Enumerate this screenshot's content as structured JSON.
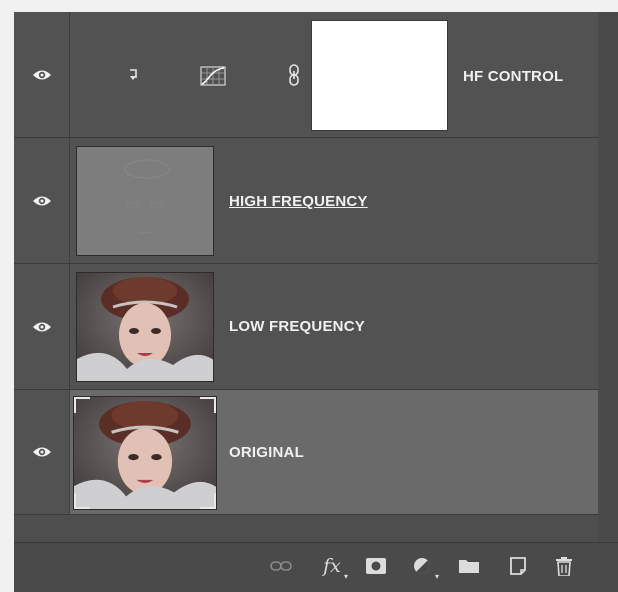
{
  "layers": [
    {
      "name": "HF CONTROL",
      "type": "adjustment"
    },
    {
      "name": "HIGH FREQUENCY",
      "type": "pixel"
    },
    {
      "name": "LOW FREQUENCY",
      "type": "pixel"
    },
    {
      "name": "ORIGINAL",
      "type": "pixel",
      "selected": true
    }
  ],
  "footer": {
    "fx_label": "fx"
  },
  "icons": [
    "eye-icon",
    "clip-arrow-icon",
    "curves-adjustment-icon",
    "chain-link-icon",
    "link-layers-icon",
    "fx-icon",
    "layer-mask-icon",
    "adjustment-layer-icon",
    "folder-icon",
    "new-layer-icon",
    "trash-icon"
  ],
  "colors": {
    "panel": "#4e4e4e",
    "row": "#525252",
    "selected_row": "#6a6a6a",
    "text": "#f0f0f0"
  }
}
